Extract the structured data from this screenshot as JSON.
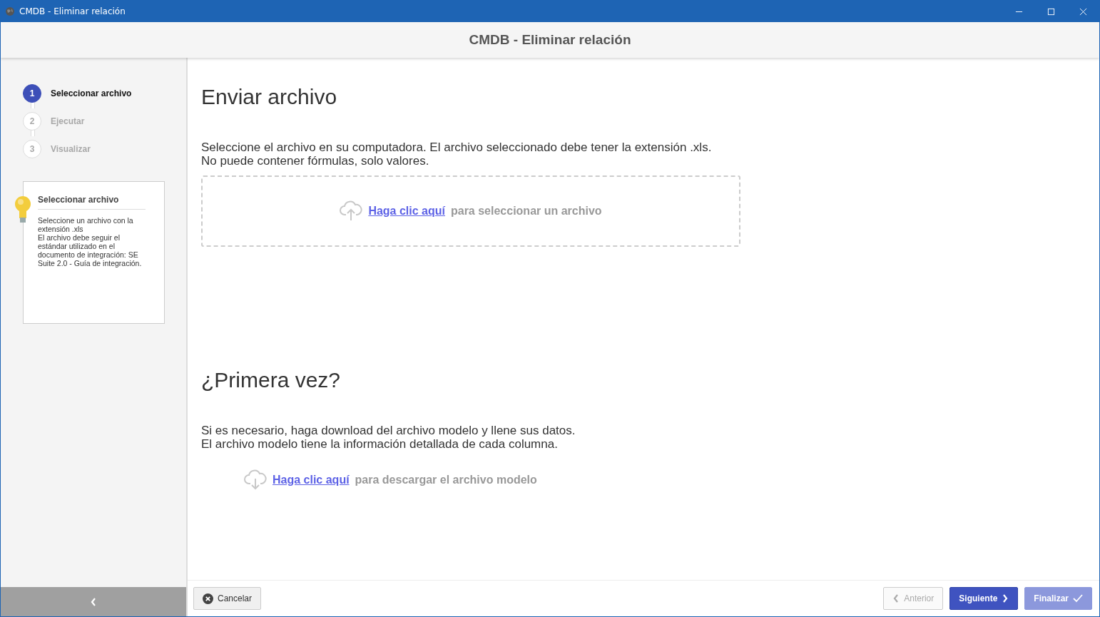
{
  "window": {
    "title": "CMDB - Eliminar relación"
  },
  "header": {
    "title": "CMDB - Eliminar relación"
  },
  "steps": [
    {
      "number": "1",
      "label": "Seleccionar archivo",
      "selected": true
    },
    {
      "number": "2",
      "label": "Ejecutar",
      "selected": false
    },
    {
      "number": "3",
      "label": "Visualizar",
      "selected": false
    }
  ],
  "help": {
    "title": "Seleccionar archivo",
    "paragraphs": [
      "Seleccione un archivo con la extensión .xls",
      "El archivo debe seguir el estándar utilizado en el documento de integración: SE Suite 2.0 - Guía de integración."
    ]
  },
  "upload": {
    "heading": "Enviar archivo",
    "lines": [
      "Seleccione el archivo en su computadora. El archivo seleccionado debe tener la extensión .xls.",
      "No puede contener fórmulas, solo valores."
    ],
    "link": "Haga clic aquí",
    "rest": "para seleccionar un archivo"
  },
  "first_time": {
    "heading": "¿Primera vez?",
    "lines": [
      "Si es necesario, haga download del archivo modelo y llene sus datos.",
      "El archivo modelo tiene la información detallada de cada columna."
    ],
    "link": "Haga clic aquí",
    "rest": "para descargar el archivo modelo"
  },
  "footer": {
    "cancel": "Cancelar",
    "buttons": [
      {
        "label": "Anterior",
        "kind": "back",
        "disabled": true
      },
      {
        "label": "Siguiente",
        "kind": "next",
        "disabled": false
      },
      {
        "label": "Finalizar",
        "kind": "finish",
        "disabled": true
      }
    ]
  }
}
